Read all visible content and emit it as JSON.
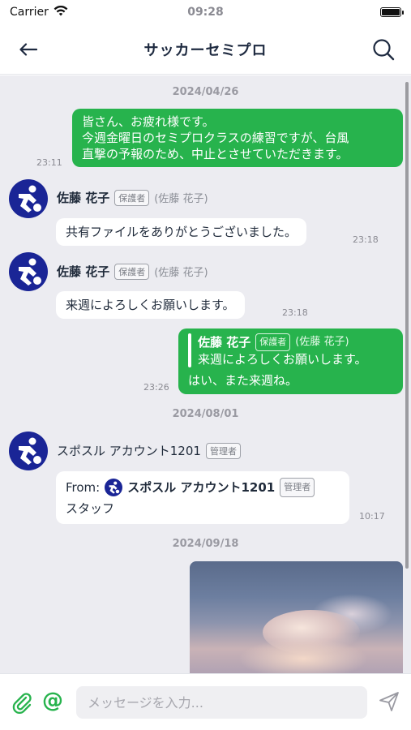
{
  "status": {
    "carrier": "Carrier",
    "time": "09:28"
  },
  "nav": {
    "title": "サッカーセミプロ"
  },
  "dates": [
    "2024/04/26",
    "2024/08/01",
    "2024/09/18"
  ],
  "messages": {
    "m1": {
      "line1": "皆さん、お疲れ様です。",
      "line2": "今週金曜日のセミプロクラスの練習ですが、台風",
      "line3": "直撃の予報のため、中止とさせていただきます。",
      "time": "23:11"
    },
    "m2": {
      "name": "佐藤 花子",
      "badge": "保護者",
      "sub": "(佐藤 花子)",
      "text": "共有ファイルをありがとうございました。",
      "time": "23:18"
    },
    "m3": {
      "name": "佐藤 花子",
      "badge": "保護者",
      "sub": "(佐藤 花子)",
      "text": "来週によろしくお願いします。",
      "time": "23:18"
    },
    "m4": {
      "quote_name": "佐藤 花子",
      "quote_badge": "保護者",
      "quote_sub": "(佐藤 花子)",
      "quote_text": "来週によろしくお願いします。",
      "text": "はい、また来週ね。",
      "time": "23:26"
    },
    "m5": {
      "name": "スポスル アカウント1201",
      "badge": "管理者",
      "from_label": "From:",
      "from_name": "スポスル アカウント1201",
      "from_badge": "管理者",
      "text": "スタッフ",
      "time": "10:17"
    }
  },
  "input": {
    "placeholder": "メッセージを入力..."
  },
  "colors": {
    "accent": "#27b34d",
    "avatar": "#1a2596",
    "chat_bg": "#ececf1"
  }
}
